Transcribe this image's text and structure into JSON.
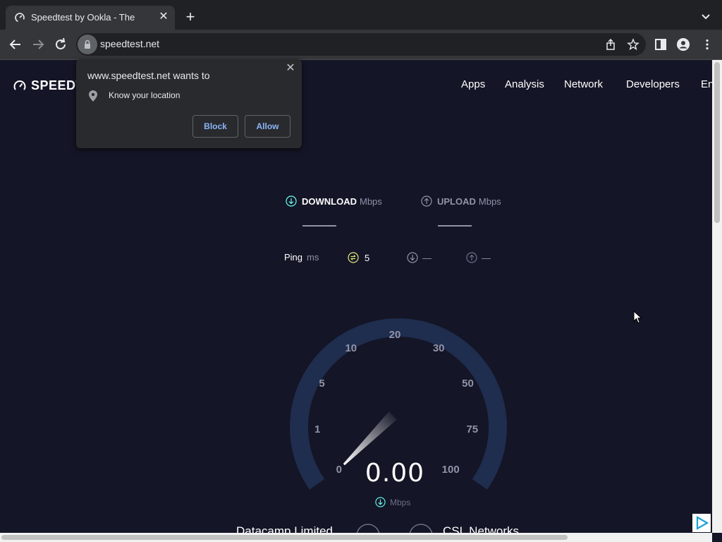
{
  "browser": {
    "tab_title": "Speedtest by Ookla - The Glob",
    "url": "speedtest.net"
  },
  "site": {
    "logo_text": "SPEEDT",
    "nav": [
      "Apps",
      "Analysis",
      "Network",
      "Developers",
      "En"
    ]
  },
  "permission_popup": {
    "title": "www.speedtest.net wants to",
    "request": "Know your location",
    "block_label": "Block",
    "allow_label": "Allow"
  },
  "test": {
    "download_label": "DOWNLOAD",
    "upload_label": "UPLOAD",
    "unit_mbps": "Mbps",
    "ping_label": "Ping",
    "ping_unit": "ms",
    "ping_value": "5",
    "download_latency": "—",
    "upload_latency": "—",
    "speed_value": "0.00",
    "speed_unit": "Mbps",
    "gauge_labels": [
      "0",
      "1",
      "5",
      "10",
      "20",
      "30",
      "50",
      "75",
      "100"
    ],
    "needle_value": 0
  },
  "providers": {
    "left": "Datacamp Limited",
    "right": "CSL Networks"
  },
  "colors": {
    "background": "#141526",
    "gauge_track": "#1f2d4e",
    "accent": "#6afff3",
    "ping_icon": "#e2e87a"
  }
}
